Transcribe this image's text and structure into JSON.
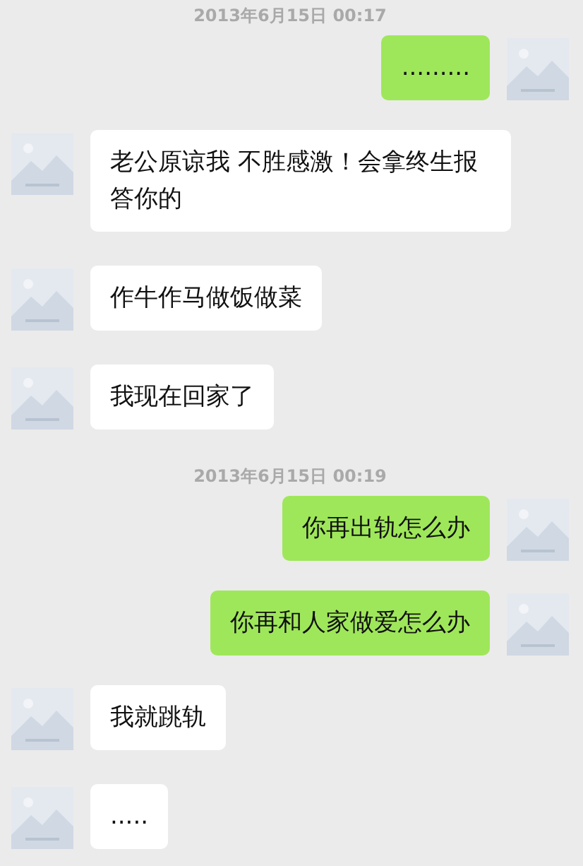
{
  "messages": [
    {
      "kind": "time",
      "text": "2013年6月15日 00:17"
    },
    {
      "kind": "sent",
      "text": "........."
    },
    {
      "kind": "received",
      "text": "老公原谅我 不胜感激！会拿终生报答你的"
    },
    {
      "kind": "received",
      "text": "作牛作马做饭做菜"
    },
    {
      "kind": "received",
      "text": "我现在回家了"
    },
    {
      "kind": "time",
      "text": "2013年6月15日 00:19"
    },
    {
      "kind": "sent",
      "text": "你再出轨怎么办"
    },
    {
      "kind": "sent",
      "text": "你再和人家做爱怎么办"
    },
    {
      "kind": "received",
      "text": "我就跳轨"
    },
    {
      "kind": "received",
      "text": "....."
    }
  ]
}
